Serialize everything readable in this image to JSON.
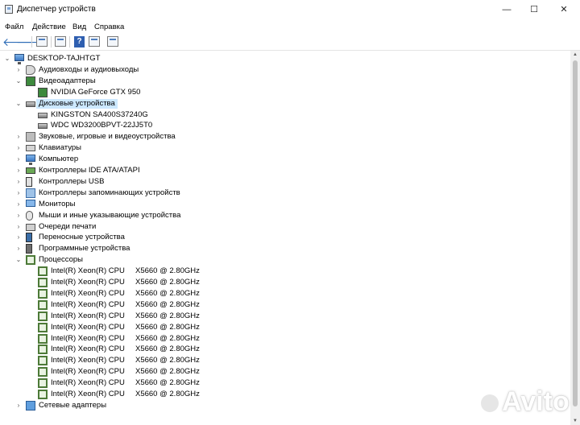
{
  "window": {
    "title": "Диспетчер устройств",
    "minimize_glyph": "—",
    "maximize_glyph": "☐",
    "close_glyph": "✕"
  },
  "menu": [
    "Файл",
    "Действие",
    "Вид",
    "Справка"
  ],
  "toolbar": {
    "icons": [
      "back-icon",
      "forward-icon",
      "properties-icon",
      "update-driver-icon",
      "help-icon",
      "show-hidden-icon",
      "scan-hardware-icon"
    ],
    "back_glyph": "🡐",
    "forward_glyph": "🡒",
    "help_glyph": "?"
  },
  "tree": {
    "root": "DESKTOP-TAJHTGT",
    "categories": [
      {
        "label": "Аудиовходы и аудиовыходы",
        "icon": "audio-icon",
        "expanded": false
      },
      {
        "label": "Видеоадаптеры",
        "icon": "display-adapter-icon",
        "expanded": true
      },
      {
        "label": "NVIDIA GeForce GTX 950",
        "icon": "display-adapter-icon",
        "child": true
      },
      {
        "label": "Дисковые устройства",
        "icon": "disk-drive-icon",
        "expanded": true,
        "selected": true
      },
      {
        "label": "KINGSTON SA400S37240G",
        "icon": "disk-drive-icon",
        "child": true
      },
      {
        "label": "WDC WD3200BPVT-22JJ5T0",
        "icon": "disk-drive-icon",
        "child": true
      },
      {
        "label": "Звуковые, игровые и видеоустройства",
        "icon": "sound-icon",
        "expanded": false
      },
      {
        "label": "Клавиатуры",
        "icon": "keyboard-icon",
        "expanded": false
      },
      {
        "label": "Компьютер",
        "icon": "computer-icon",
        "expanded": false
      },
      {
        "label": "Контроллеры IDE ATA/ATAPI",
        "icon": "ide-controller-icon",
        "expanded": false
      },
      {
        "label": "Контроллеры USB",
        "icon": "usb-icon",
        "expanded": false
      },
      {
        "label": "Контроллеры запоминающих устройств",
        "icon": "storage-controller-icon",
        "expanded": false
      },
      {
        "label": "Мониторы",
        "icon": "monitor-icon",
        "expanded": false
      },
      {
        "label": "Мыши и иные указывающие устройства",
        "icon": "mouse-icon",
        "expanded": false
      },
      {
        "label": "Очереди печати",
        "icon": "printer-icon",
        "expanded": false
      },
      {
        "label": "Переносные устройства",
        "icon": "portable-device-icon",
        "expanded": false
      },
      {
        "label": "Программные устройства",
        "icon": "software-device-icon",
        "expanded": false
      },
      {
        "label": "Процессоры",
        "icon": "processor-icon",
        "expanded": true
      }
    ],
    "processors": {
      "name": "Intel(R) Xeon(R) CPU",
      "model": "X5660  @ 2.80GHz",
      "count": 12
    },
    "last_category": {
      "label": "Сетевые адаптеры",
      "icon": "network-adapter-icon",
      "expanded": false
    }
  },
  "watermark": "Avito"
}
